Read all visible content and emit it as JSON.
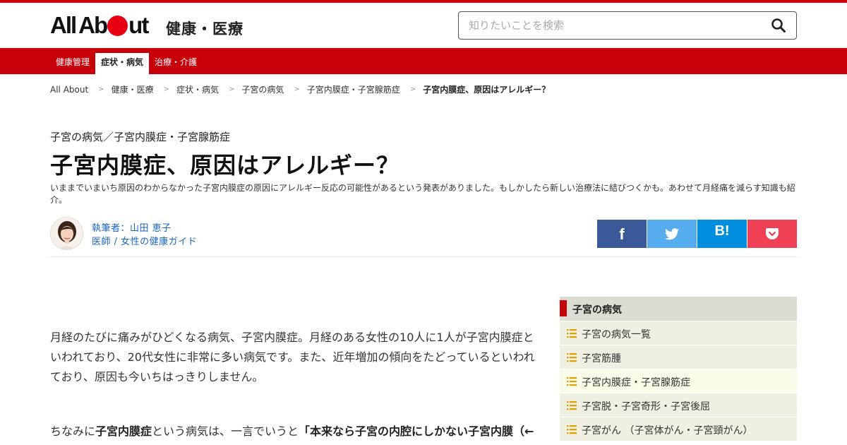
{
  "header": {
    "logo_text_pre": "All",
    "logo_text_mid": "Ab",
    "logo_text_post": "ut",
    "site_name": "健康・医療",
    "search_placeholder": "知りたいことを検索"
  },
  "nav": {
    "items": [
      {
        "label": "健康管理",
        "active": false
      },
      {
        "label": "症状・病気",
        "active": true
      },
      {
        "label": "治療・介護",
        "active": false
      }
    ]
  },
  "breadcrumb": [
    "All About",
    "健康・医療",
    "症状・病気",
    "子宮の病気",
    "子宮内膜症・子宮腺筋症",
    "子宮内膜症、原因はアレルギー？"
  ],
  "article": {
    "kicker": "子宮の病気／子宮内膜症・子宮腺筋症",
    "title": "子宮内膜症、原因はアレルギー？",
    "lead": "いままでいまいち原因のわからなかった子宮内膜症の原因にアレルギー反応の可能性があるという発表がありました。もしかしたら新しい治療法に結びつくかも。あわせて月経痛を減らす知識も紹介。",
    "author_name": "執筆者：山田 恵子",
    "author_role": "医師 / 女性の健康ガイド",
    "p1": "月経のたびに痛みがひどくなる病気、子宮内膜症。月経のある女性の10人に1人が子宮内膜症といわれており、20代女性に非常に多い病気です。また、近年増加の傾向をたどっているといわれており、原因も今いちはっきりしません。",
    "p2_pre": "ちなみに",
    "p2_bold1": "子宮内膜症",
    "p2_mid": "という病気は、一言でいうと",
    "p2_bold2": "「本来なら子宮の内腔にしかない子宮内膜（←"
  },
  "share": {
    "fb": "f",
    "hb": "B!"
  },
  "sidebar": {
    "title": "子宮の病気",
    "items": [
      {
        "label": "子宮の病気一覧"
      },
      {
        "label": "子宮筋腫"
      },
      {
        "label": "子宮内膜症・子宮腺筋症"
      },
      {
        "label": "子宮脱・子宮奇形・子宮後屈"
      },
      {
        "label": "子宮がん （子宮体がん・子宮頸がん）"
      }
    ]
  },
  "colors": {
    "brand_red": "#c8000a",
    "facebook": "#3b5998",
    "twitter": "#55acee",
    "hatena": "#008fde",
    "pocket": "#ef4056"
  }
}
